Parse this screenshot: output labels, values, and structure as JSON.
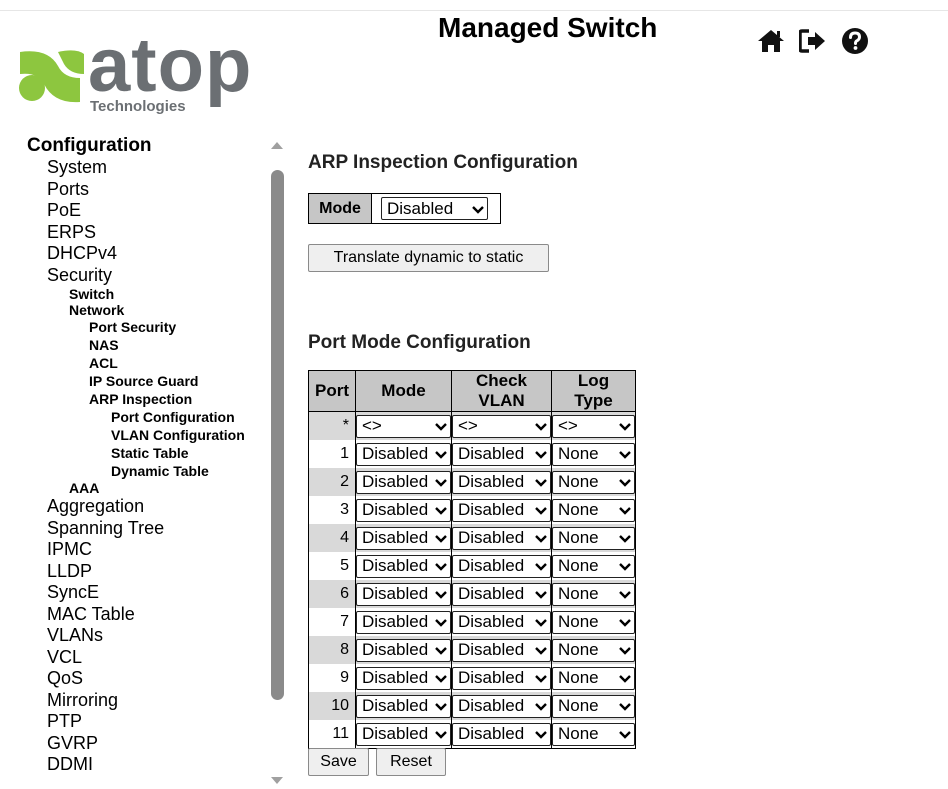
{
  "header": {
    "title": "Managed Switch",
    "logo_text": "atop",
    "logo_subtext": "Technologies",
    "icons": [
      "home-icon",
      "logout-icon",
      "help-icon"
    ]
  },
  "sidebar": {
    "items": [
      {
        "label": "Configuration",
        "level": 0
      },
      {
        "label": "System",
        "level": 1
      },
      {
        "label": "Ports",
        "level": 1
      },
      {
        "label": "PoE",
        "level": 1
      },
      {
        "label": "ERPS",
        "level": 1
      },
      {
        "label": "DHCPv4",
        "level": 1
      },
      {
        "label": "Security",
        "level": 1
      },
      {
        "label": "Switch",
        "level": 2
      },
      {
        "label": "Network",
        "level": 2
      },
      {
        "label": "Port Security",
        "level": 3
      },
      {
        "label": "NAS",
        "level": 3
      },
      {
        "label": "ACL",
        "level": 3
      },
      {
        "label": "IP Source Guard",
        "level": 3
      },
      {
        "label": "ARP Inspection",
        "level": 3
      },
      {
        "label": "Port Configuration",
        "level": 4
      },
      {
        "label": "VLAN Configuration",
        "level": 4
      },
      {
        "label": "Static Table",
        "level": 4
      },
      {
        "label": "Dynamic Table",
        "level": 4
      },
      {
        "label": "AAA",
        "level": 2
      },
      {
        "label": "Aggregation",
        "level": 1
      },
      {
        "label": "Spanning Tree",
        "level": 1
      },
      {
        "label": "IPMC",
        "level": 1
      },
      {
        "label": "LLDP",
        "level": 1
      },
      {
        "label": "SyncE",
        "level": 1
      },
      {
        "label": "MAC Table",
        "level": 1
      },
      {
        "label": "VLANs",
        "level": 1
      },
      {
        "label": "VCL",
        "level": 1
      },
      {
        "label": "QoS",
        "level": 1
      },
      {
        "label": "Mirroring",
        "level": 1
      },
      {
        "label": "PTP",
        "level": 1
      },
      {
        "label": "GVRP",
        "level": 1
      },
      {
        "label": "DDMI",
        "level": 1
      }
    ]
  },
  "arp": {
    "heading": "ARP Inspection Configuration",
    "mode_label": "Mode",
    "mode_value": "Disabled",
    "translate_button": "Translate dynamic to static"
  },
  "port_mode": {
    "heading": "Port Mode Configuration",
    "columns": [
      "Port",
      "Mode",
      "Check VLAN",
      "Log Type"
    ],
    "wildcard": {
      "port": "*",
      "mode": "<>",
      "check_vlan": "<>",
      "log_type": "<>"
    },
    "rows": [
      {
        "port": "1",
        "mode": "Disabled",
        "check_vlan": "Disabled",
        "log_type": "None"
      },
      {
        "port": "2",
        "mode": "Disabled",
        "check_vlan": "Disabled",
        "log_type": "None"
      },
      {
        "port": "3",
        "mode": "Disabled",
        "check_vlan": "Disabled",
        "log_type": "None"
      },
      {
        "port": "4",
        "mode": "Disabled",
        "check_vlan": "Disabled",
        "log_type": "None"
      },
      {
        "port": "5",
        "mode": "Disabled",
        "check_vlan": "Disabled",
        "log_type": "None"
      },
      {
        "port": "6",
        "mode": "Disabled",
        "check_vlan": "Disabled",
        "log_type": "None"
      },
      {
        "port": "7",
        "mode": "Disabled",
        "check_vlan": "Disabled",
        "log_type": "None"
      },
      {
        "port": "8",
        "mode": "Disabled",
        "check_vlan": "Disabled",
        "log_type": "None"
      },
      {
        "port": "9",
        "mode": "Disabled",
        "check_vlan": "Disabled",
        "log_type": "None"
      },
      {
        "port": "10",
        "mode": "Disabled",
        "check_vlan": "Disabled",
        "log_type": "None"
      },
      {
        "port": "11",
        "mode": "Disabled",
        "check_vlan": "Disabled",
        "log_type": "None"
      }
    ]
  },
  "actions": {
    "save": "Save",
    "reset": "Reset"
  },
  "colors": {
    "logo_green": "#8dc63f",
    "logo_gray": "#6b6f73",
    "header_gray": "#c6c6c6",
    "row_alt": "#d9d9d9"
  }
}
